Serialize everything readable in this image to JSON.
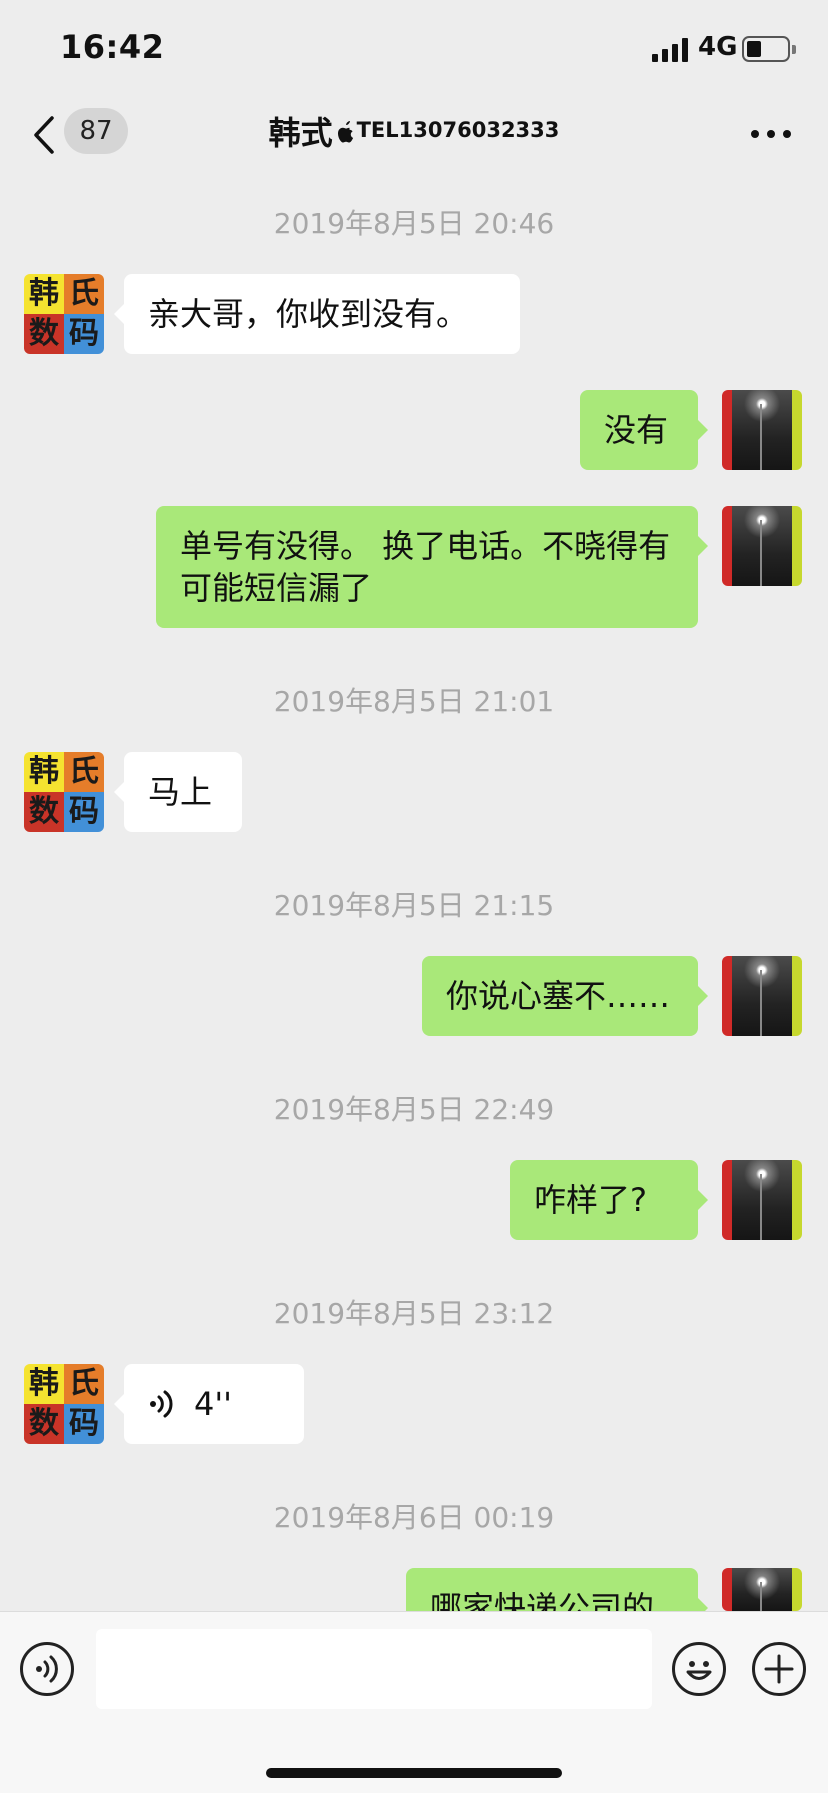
{
  "status_bar": {
    "time": "16:42",
    "network": "4G",
    "battery_level": 0.3
  },
  "header": {
    "unread_count": "87",
    "contact_name": "韩式",
    "contact_tel": "TEL13076032333"
  },
  "messages": [
    {
      "kind": "timestamp",
      "text": "2019年8月5日 20:46"
    },
    {
      "kind": "incoming",
      "text": "亲大哥，你收到没有。"
    },
    {
      "kind": "outgoing",
      "text": "没有"
    },
    {
      "kind": "outgoing",
      "text": "单号有没得。 换了电话。不晓得有可能短信漏了"
    },
    {
      "kind": "timestamp",
      "text": "2019年8月5日 21:01"
    },
    {
      "kind": "incoming",
      "text": "马上"
    },
    {
      "kind": "timestamp",
      "text": "2019年8月5日 21:15"
    },
    {
      "kind": "outgoing",
      "text": "你说心塞不……"
    },
    {
      "kind": "timestamp",
      "text": "2019年8月5日 22:49"
    },
    {
      "kind": "outgoing",
      "text": "咋样了?"
    },
    {
      "kind": "timestamp",
      "text": "2019年8月5日 23:12"
    },
    {
      "kind": "incoming-voice",
      "duration": "4''"
    },
    {
      "kind": "timestamp",
      "text": "2019年8月6日 00:19"
    },
    {
      "kind": "outgoing",
      "text": "哪家快递公司的"
    }
  ],
  "avatar_contact_chars": [
    "韩",
    "氏",
    "数",
    "码"
  ],
  "input": {
    "value": ""
  }
}
